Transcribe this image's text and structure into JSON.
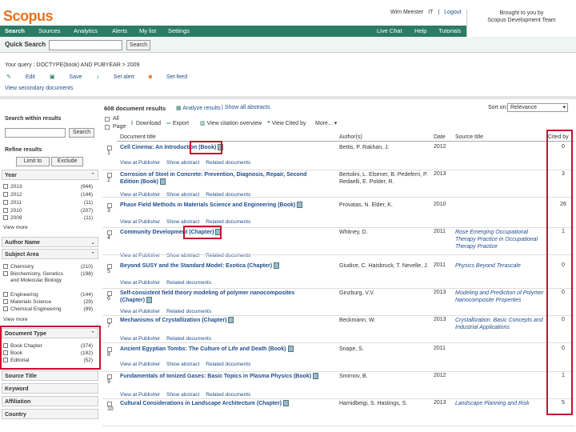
{
  "header": {
    "logo": "Scopus",
    "user_name": "Wim Meester",
    "user_flag": "IT",
    "logout": "Logout",
    "brought_by_line1": "Brought to you by",
    "brought_by_line2": "Scopus Development Team"
  },
  "nav": {
    "items": [
      "Search",
      "Sources",
      "Analytics",
      "Alerts",
      "My list",
      "Settings"
    ],
    "right": [
      "Live Chat",
      "Help",
      "Tutorials"
    ]
  },
  "quick_search": {
    "label": "Quick Search",
    "button": "Search"
  },
  "results_info": {
    "your_query": "Your query : DOCTYPE(book) AND PUBYEAR > 2009",
    "actions": [
      "Edit",
      "Save",
      "Set alert",
      "Set feed"
    ],
    "view_secondary": "View secondary documents"
  },
  "sidebar": {
    "search_within": "Search within results",
    "search_button": "Search",
    "refine": "Refine results",
    "limit_to": "Limit to",
    "exclude": "Exclude",
    "year_label": "Year",
    "years": [
      {
        "label": "2013",
        "count": "(944)"
      },
      {
        "label": "2012",
        "count": "(144)"
      },
      {
        "label": "2011",
        "count": "(11)"
      },
      {
        "label": "2010",
        "count": "(207)"
      },
      {
        "label": "2009",
        "count": "(11)"
      }
    ],
    "view_more1": "View more",
    "author_name": "Author Name",
    "subject_area": "Subject Area",
    "subjects": [
      {
        "label": "Chemistry",
        "count": "(210)"
      },
      {
        "label": "Biochemistry, Genetics and Molecular Biology",
        "count": "(198)"
      },
      {
        "label": "Engineering",
        "count": "(144)"
      },
      {
        "label": "Materials Science",
        "count": "(29)"
      },
      {
        "label": "Chemical Engineering",
        "count": "(99)"
      }
    ],
    "view_more2": "View more",
    "doc_type": "Document Type",
    "doctypes": [
      {
        "label": "Book Chapter",
        "count": "(374)"
      },
      {
        "label": "Book",
        "count": "(182)"
      },
      {
        "label": "Editorial",
        "count": "(52)"
      }
    ],
    "source_title": "Source Title",
    "keyword": "Keyword",
    "affiliation": "Affiliation",
    "country": "Country"
  },
  "toolbar": {
    "count": "608 document results",
    "analyze": "Analyze results",
    "show_all": "Show all abstracts",
    "sort_label": "Sort on:",
    "sort_value": "Relevance",
    "all": "All",
    "page": "Page",
    "download": "Download",
    "export": "Export",
    "view_citation": "View citation overview",
    "view_cited": "View Cited by",
    "more": "More..."
  },
  "columns": [
    "Document title",
    "Author(s)",
    "Date",
    "Source title",
    "Cited by"
  ],
  "rows": [
    {
      "n": "1",
      "title": "Cell Cinema: An Introduction (Book)",
      "author": "Bettis, P. Rakhan, J.",
      "year": "2012",
      "src": "",
      "cited": "0",
      "links": [
        "View at Publisher",
        "Show abstract",
        "Related documents"
      ]
    },
    {
      "n": "2",
      "title": "Corrosion of Steel in Concrete: Prevention, Diagnosis, Repair, Second Edition (Book)",
      "author": "Bertolini, L. Elsener, B. Pedeferri, P. Redaelli, E. Polder, R.",
      "year": "2013",
      "src": "",
      "cited": "3",
      "links": [
        "View at Publisher",
        "Show abstract",
        "Related documents"
      ]
    },
    {
      "n": "3",
      "title": "Phase Field Methods in Materials Science and Engineering (Book)",
      "author": "Provatas, N. Elder, K.",
      "year": "2010",
      "src": "",
      "cited": "26",
      "links": [
        "View at Publisher",
        "Show abstract",
        "Related documents"
      ]
    },
    {
      "n": "4",
      "title": "Community Development (Chapter)",
      "author": "Whitney, D.",
      "year": "2011",
      "src": "Rose Emerging Occupational Therapy Practice in Occupational Therapy Practice",
      "cited": "1",
      "links": [
        "View at Publisher",
        "Show abstract",
        "Related documents"
      ]
    },
    {
      "n": "5",
      "title": "Beyond SUSY and the Standard Model: Exotica (Chapter)",
      "author": "Giudice, C. Haisbruck, T. Nevelle, J.",
      "year": "2011",
      "src": "Physics Beyond Terascale",
      "cited": "0",
      "links": [
        "View at Publisher",
        "Related documents"
      ]
    },
    {
      "n": "6",
      "title": "Self-consistent field theory modeling of polymer nanocomposites (Chapter)",
      "author": "Ginzburg, V.V.",
      "year": "2013",
      "src": "Modeling and Prediction of Polymer Nanocomposite Properties",
      "cited": "0",
      "links": [
        "View at Publisher",
        "Related documents"
      ]
    },
    {
      "n": "7",
      "title": "Mechanisms of Crystallization (Chapter)",
      "author": "Beckmann, W.",
      "year": "2013",
      "src": "Crystallization: Basic Concepts and Industrial Applications",
      "cited": "0",
      "links": [
        "View at Publisher",
        "Related documents"
      ]
    },
    {
      "n": "8",
      "title": "Ancient Egyptian Tombs: The Culture of Life and Death (Book)",
      "author": "Snape, S.",
      "year": "2011",
      "src": "",
      "cited": "0",
      "links": [
        "View at Publisher",
        "Show abstract",
        "Related documents"
      ]
    },
    {
      "n": "9",
      "title": "Fundamentals of Ionized Gases: Basic Topics in Plasma Physics (Book)",
      "author": "Smirnov, B.",
      "year": "2012",
      "src": "",
      "cited": "1",
      "links": [
        "View at Publisher",
        "Show abstract",
        "Related documents"
      ]
    },
    {
      "n": "10",
      "title": "Cultural Considerations in Landscape Architecture (Chapter)",
      "author": "Hamidbeigi, S. Hastings, S.",
      "year": "2013",
      "src": "Landscape Planning and Risk",
      "cited": "5",
      "links": []
    }
  ]
}
